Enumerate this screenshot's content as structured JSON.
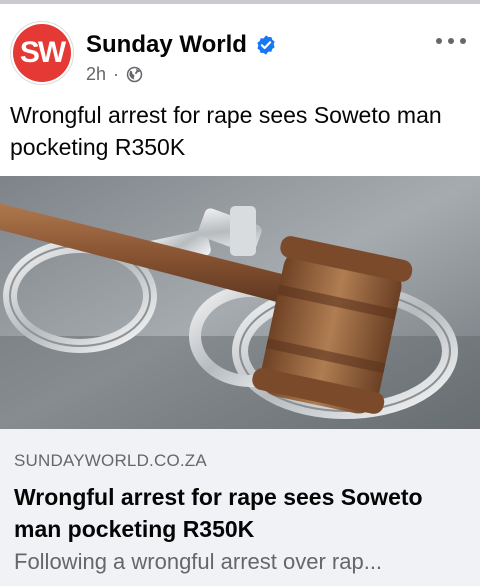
{
  "header": {
    "avatar_text": "SW",
    "page_name": "Sunday World",
    "time": "2h",
    "separator": "·",
    "verified_icon": "verified-badge-icon",
    "audience_icon": "globe-icon",
    "more_icon": "more-options-icon"
  },
  "post": {
    "text": "Wrongful arrest for rape sees Soweto man pocketing R350K"
  },
  "image": {
    "subject": "judge gavel on handcuffs"
  },
  "link_preview": {
    "domain": "SUNDAYWORLD.CO.ZA",
    "title": "Wrongful arrest for rape sees Soweto man pocketing R350K",
    "description": "Following a wrongful arrest over rap..."
  },
  "colors": {
    "brand": "#e53935",
    "verified": "#1877f2",
    "secondary_text": "#65676b",
    "link_background": "#f0f2f5"
  }
}
